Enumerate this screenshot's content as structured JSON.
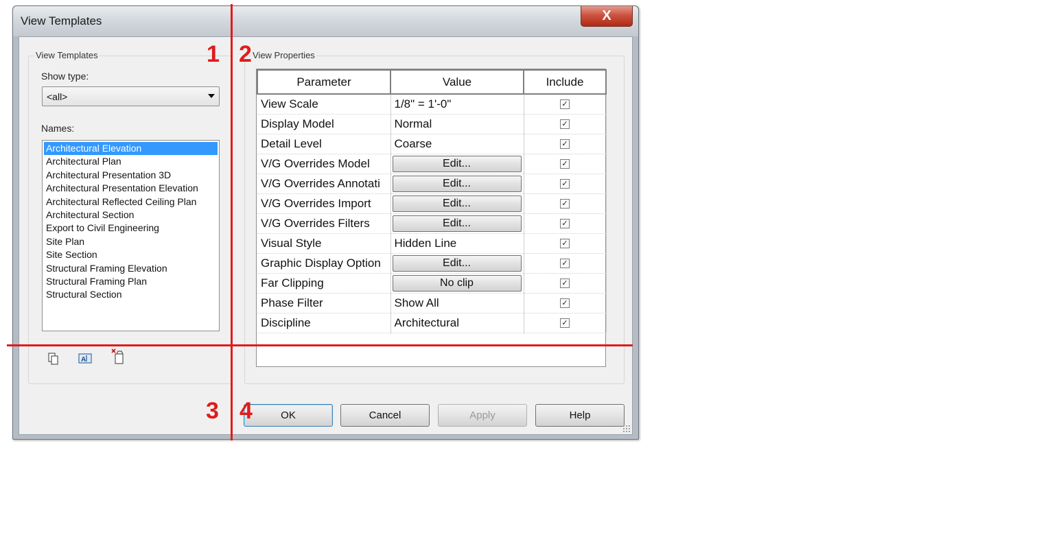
{
  "window": {
    "title": "View Templates",
    "close_glyph": "X"
  },
  "left_panel": {
    "group_label": "View Templates",
    "show_type_label": "Show type:",
    "show_type_value": "<all>",
    "names_label": "Names:",
    "names": [
      "Architectural Elevation",
      "Architectural Plan",
      "Architectural Presentation 3D",
      "Architectural Presentation Elevation",
      "Architectural Reflected Ceiling Plan",
      "Architectural Section",
      "Export to Civil Engineering",
      "Site Plan",
      "Site Section",
      "Structural Framing Elevation",
      "Structural Framing Plan",
      "Structural Section"
    ],
    "selected_index": 0,
    "icons": [
      "duplicate-icon",
      "rename-icon",
      "delete-icon"
    ]
  },
  "right_panel": {
    "group_label": "View Properties",
    "columns": [
      "Parameter",
      "Value",
      "Include"
    ],
    "rows": [
      {
        "param": "View Scale",
        "value": "1/8\" = 1'-0\"",
        "is_button": false,
        "include": true
      },
      {
        "param": "Display Model",
        "value": "Normal",
        "is_button": false,
        "include": true
      },
      {
        "param": "Detail Level",
        "value": "Coarse",
        "is_button": false,
        "include": true
      },
      {
        "param": "V/G Overrides Model",
        "value": "Edit...",
        "is_button": true,
        "include": true
      },
      {
        "param": "V/G Overrides Annotati",
        "value": "Edit...",
        "is_button": true,
        "include": true
      },
      {
        "param": "V/G Overrides Import",
        "value": "Edit...",
        "is_button": true,
        "include": true
      },
      {
        "param": "V/G Overrides Filters",
        "value": "Edit...",
        "is_button": true,
        "include": true
      },
      {
        "param": "Visual Style",
        "value": "Hidden Line",
        "is_button": false,
        "include": true
      },
      {
        "param": "Graphic Display Option",
        "value": "Edit...",
        "is_button": true,
        "include": true
      },
      {
        "param": "Far Clipping",
        "value": "No clip",
        "is_button": true,
        "include": true
      },
      {
        "param": "Phase Filter",
        "value": "Show All",
        "is_button": false,
        "include": true
      },
      {
        "param": "Discipline",
        "value": "Architectural",
        "is_button": false,
        "include": true
      }
    ]
  },
  "buttons": {
    "ok": "OK",
    "cancel": "Cancel",
    "apply": "Apply",
    "help": "Help"
  },
  "annotations": {
    "n1": "1",
    "n2": "2",
    "n3": "3",
    "n4": "4",
    "color": "#e01b1b"
  },
  "colors": {
    "selection": "#3399ff",
    "close_button": "#c23b22"
  }
}
